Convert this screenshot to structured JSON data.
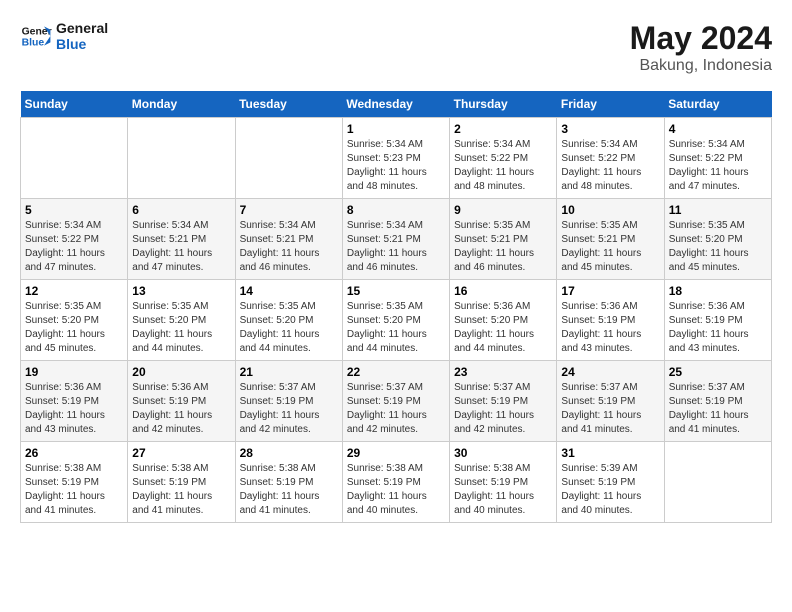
{
  "header": {
    "logo_general": "General",
    "logo_blue": "Blue",
    "month_title": "May 2024",
    "location": "Bakung, Indonesia"
  },
  "weekdays": [
    "Sunday",
    "Monday",
    "Tuesday",
    "Wednesday",
    "Thursday",
    "Friday",
    "Saturday"
  ],
  "weeks": [
    [
      {
        "day": "",
        "sunrise": "",
        "sunset": "",
        "daylight": ""
      },
      {
        "day": "",
        "sunrise": "",
        "sunset": "",
        "daylight": ""
      },
      {
        "day": "",
        "sunrise": "",
        "sunset": "",
        "daylight": ""
      },
      {
        "day": "1",
        "sunrise": "Sunrise: 5:34 AM",
        "sunset": "Sunset: 5:23 PM",
        "daylight": "Daylight: 11 hours and 48 minutes."
      },
      {
        "day": "2",
        "sunrise": "Sunrise: 5:34 AM",
        "sunset": "Sunset: 5:22 PM",
        "daylight": "Daylight: 11 hours and 48 minutes."
      },
      {
        "day": "3",
        "sunrise": "Sunrise: 5:34 AM",
        "sunset": "Sunset: 5:22 PM",
        "daylight": "Daylight: 11 hours and 48 minutes."
      },
      {
        "day": "4",
        "sunrise": "Sunrise: 5:34 AM",
        "sunset": "Sunset: 5:22 PM",
        "daylight": "Daylight: 11 hours and 47 minutes."
      }
    ],
    [
      {
        "day": "5",
        "sunrise": "Sunrise: 5:34 AM",
        "sunset": "Sunset: 5:22 PM",
        "daylight": "Daylight: 11 hours and 47 minutes."
      },
      {
        "day": "6",
        "sunrise": "Sunrise: 5:34 AM",
        "sunset": "Sunset: 5:21 PM",
        "daylight": "Daylight: 11 hours and 47 minutes."
      },
      {
        "day": "7",
        "sunrise": "Sunrise: 5:34 AM",
        "sunset": "Sunset: 5:21 PM",
        "daylight": "Daylight: 11 hours and 46 minutes."
      },
      {
        "day": "8",
        "sunrise": "Sunrise: 5:34 AM",
        "sunset": "Sunset: 5:21 PM",
        "daylight": "Daylight: 11 hours and 46 minutes."
      },
      {
        "day": "9",
        "sunrise": "Sunrise: 5:35 AM",
        "sunset": "Sunset: 5:21 PM",
        "daylight": "Daylight: 11 hours and 46 minutes."
      },
      {
        "day": "10",
        "sunrise": "Sunrise: 5:35 AM",
        "sunset": "Sunset: 5:21 PM",
        "daylight": "Daylight: 11 hours and 45 minutes."
      },
      {
        "day": "11",
        "sunrise": "Sunrise: 5:35 AM",
        "sunset": "Sunset: 5:20 PM",
        "daylight": "Daylight: 11 hours and 45 minutes."
      }
    ],
    [
      {
        "day": "12",
        "sunrise": "Sunrise: 5:35 AM",
        "sunset": "Sunset: 5:20 PM",
        "daylight": "Daylight: 11 hours and 45 minutes."
      },
      {
        "day": "13",
        "sunrise": "Sunrise: 5:35 AM",
        "sunset": "Sunset: 5:20 PM",
        "daylight": "Daylight: 11 hours and 44 minutes."
      },
      {
        "day": "14",
        "sunrise": "Sunrise: 5:35 AM",
        "sunset": "Sunset: 5:20 PM",
        "daylight": "Daylight: 11 hours and 44 minutes."
      },
      {
        "day": "15",
        "sunrise": "Sunrise: 5:35 AM",
        "sunset": "Sunset: 5:20 PM",
        "daylight": "Daylight: 11 hours and 44 minutes."
      },
      {
        "day": "16",
        "sunrise": "Sunrise: 5:36 AM",
        "sunset": "Sunset: 5:20 PM",
        "daylight": "Daylight: 11 hours and 44 minutes."
      },
      {
        "day": "17",
        "sunrise": "Sunrise: 5:36 AM",
        "sunset": "Sunset: 5:19 PM",
        "daylight": "Daylight: 11 hours and 43 minutes."
      },
      {
        "day": "18",
        "sunrise": "Sunrise: 5:36 AM",
        "sunset": "Sunset: 5:19 PM",
        "daylight": "Daylight: 11 hours and 43 minutes."
      }
    ],
    [
      {
        "day": "19",
        "sunrise": "Sunrise: 5:36 AM",
        "sunset": "Sunset: 5:19 PM",
        "daylight": "Daylight: 11 hours and 43 minutes."
      },
      {
        "day": "20",
        "sunrise": "Sunrise: 5:36 AM",
        "sunset": "Sunset: 5:19 PM",
        "daylight": "Daylight: 11 hours and 42 minutes."
      },
      {
        "day": "21",
        "sunrise": "Sunrise: 5:37 AM",
        "sunset": "Sunset: 5:19 PM",
        "daylight": "Daylight: 11 hours and 42 minutes."
      },
      {
        "day": "22",
        "sunrise": "Sunrise: 5:37 AM",
        "sunset": "Sunset: 5:19 PM",
        "daylight": "Daylight: 11 hours and 42 minutes."
      },
      {
        "day": "23",
        "sunrise": "Sunrise: 5:37 AM",
        "sunset": "Sunset: 5:19 PM",
        "daylight": "Daylight: 11 hours and 42 minutes."
      },
      {
        "day": "24",
        "sunrise": "Sunrise: 5:37 AM",
        "sunset": "Sunset: 5:19 PM",
        "daylight": "Daylight: 11 hours and 41 minutes."
      },
      {
        "day": "25",
        "sunrise": "Sunrise: 5:37 AM",
        "sunset": "Sunset: 5:19 PM",
        "daylight": "Daylight: 11 hours and 41 minutes."
      }
    ],
    [
      {
        "day": "26",
        "sunrise": "Sunrise: 5:38 AM",
        "sunset": "Sunset: 5:19 PM",
        "daylight": "Daylight: 11 hours and 41 minutes."
      },
      {
        "day": "27",
        "sunrise": "Sunrise: 5:38 AM",
        "sunset": "Sunset: 5:19 PM",
        "daylight": "Daylight: 11 hours and 41 minutes."
      },
      {
        "day": "28",
        "sunrise": "Sunrise: 5:38 AM",
        "sunset": "Sunset: 5:19 PM",
        "daylight": "Daylight: 11 hours and 41 minutes."
      },
      {
        "day": "29",
        "sunrise": "Sunrise: 5:38 AM",
        "sunset": "Sunset: 5:19 PM",
        "daylight": "Daylight: 11 hours and 40 minutes."
      },
      {
        "day": "30",
        "sunrise": "Sunrise: 5:38 AM",
        "sunset": "Sunset: 5:19 PM",
        "daylight": "Daylight: 11 hours and 40 minutes."
      },
      {
        "day": "31",
        "sunrise": "Sunrise: 5:39 AM",
        "sunset": "Sunset: 5:19 PM",
        "daylight": "Daylight: 11 hours and 40 minutes."
      },
      {
        "day": "",
        "sunrise": "",
        "sunset": "",
        "daylight": ""
      }
    ]
  ]
}
